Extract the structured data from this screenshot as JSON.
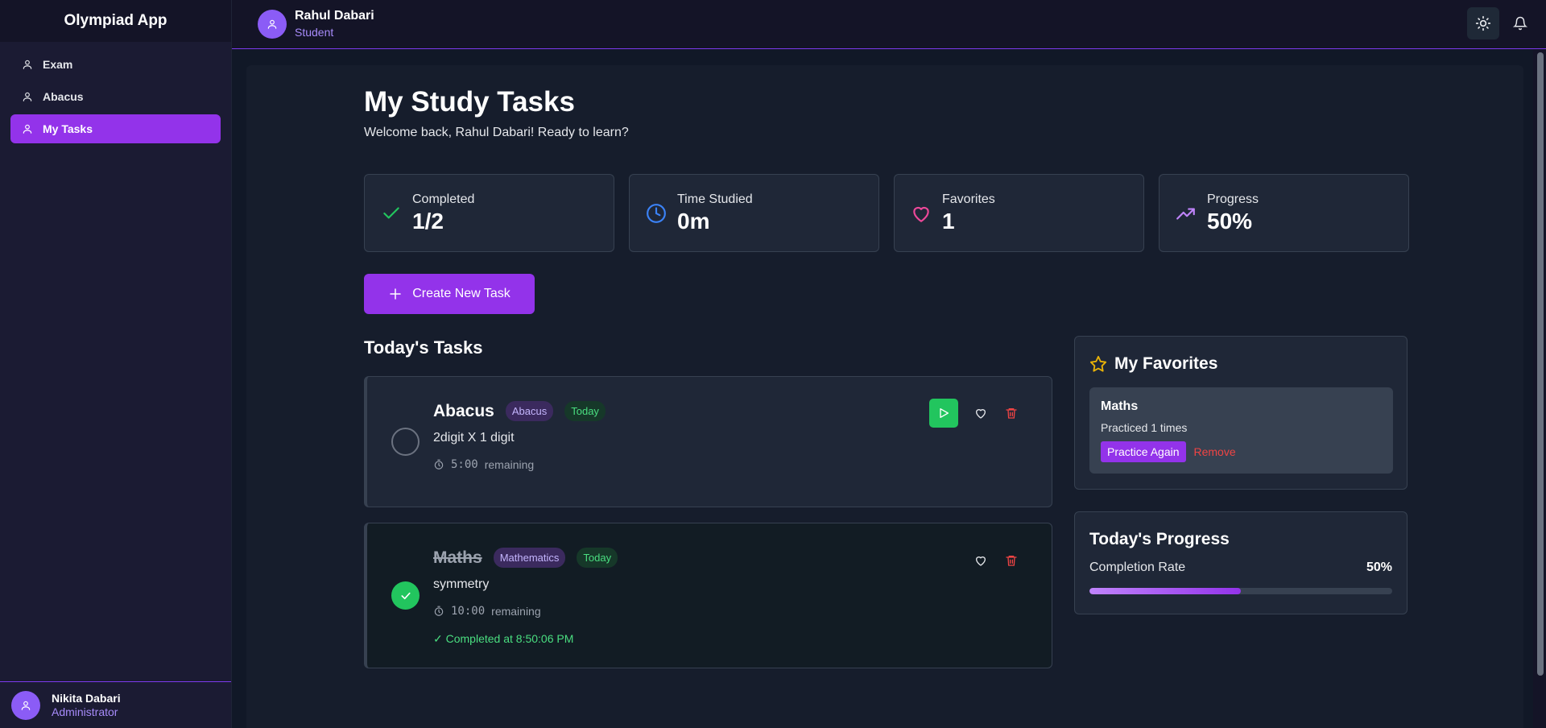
{
  "app": {
    "name": "Olympiad App"
  },
  "sidebar": {
    "items": [
      {
        "label": "Exam",
        "icon": "user-icon"
      },
      {
        "label": "Abacus",
        "icon": "user-icon"
      },
      {
        "label": "My Tasks",
        "icon": "user-icon",
        "active": true
      }
    ],
    "footer_user": {
      "name": "Nikita Dabari",
      "role": "Administrator"
    }
  },
  "header": {
    "user_name": "Rahul Dabari",
    "user_role": "Student",
    "theme_icon": "sun-icon",
    "notifications_icon": "bell-icon"
  },
  "page": {
    "title": "My Study Tasks",
    "subtitle": "Welcome back, Rahul Dabari! Ready to learn?"
  },
  "stats": [
    {
      "label": "Completed",
      "value": "1/2",
      "icon": "check-icon",
      "color": "#22c55e"
    },
    {
      "label": "Time Studied",
      "value": "0m",
      "icon": "clock-icon",
      "color": "#3b82f6"
    },
    {
      "label": "Favorites",
      "value": "1",
      "icon": "heart-icon",
      "color": "#ec4899"
    },
    {
      "label": "Progress",
      "value": "50%",
      "icon": "trending-up-icon",
      "color": "#c084fc"
    }
  ],
  "create_button": "Create New Task",
  "tasks_section": {
    "title": "Today's Tasks"
  },
  "tasks": [
    {
      "name": "Abacus",
      "category": "Abacus",
      "day": "Today",
      "description": "2digit X 1 digit",
      "time": "5:00",
      "time_suffix": "remaining",
      "completed": false
    },
    {
      "name": "Maths",
      "category": "Mathematics",
      "day": "Today",
      "description": "symmetry",
      "time": "10:00",
      "time_suffix": "remaining",
      "completed": true,
      "completed_text": "✓ Completed at 8:50:06 PM"
    }
  ],
  "favorites": {
    "title": "My Favorites",
    "items": [
      {
        "name": "Maths",
        "meta": "Practiced 1 times",
        "practice_label": "Practice Again",
        "remove_label": "Remove"
      }
    ]
  },
  "progress": {
    "title": "Today's Progress",
    "label": "Completion Rate",
    "value": "50%",
    "fraction": 0.5
  },
  "colors": {
    "accent": "#9333ea",
    "success": "#22c55e",
    "danger": "#ef4444"
  }
}
